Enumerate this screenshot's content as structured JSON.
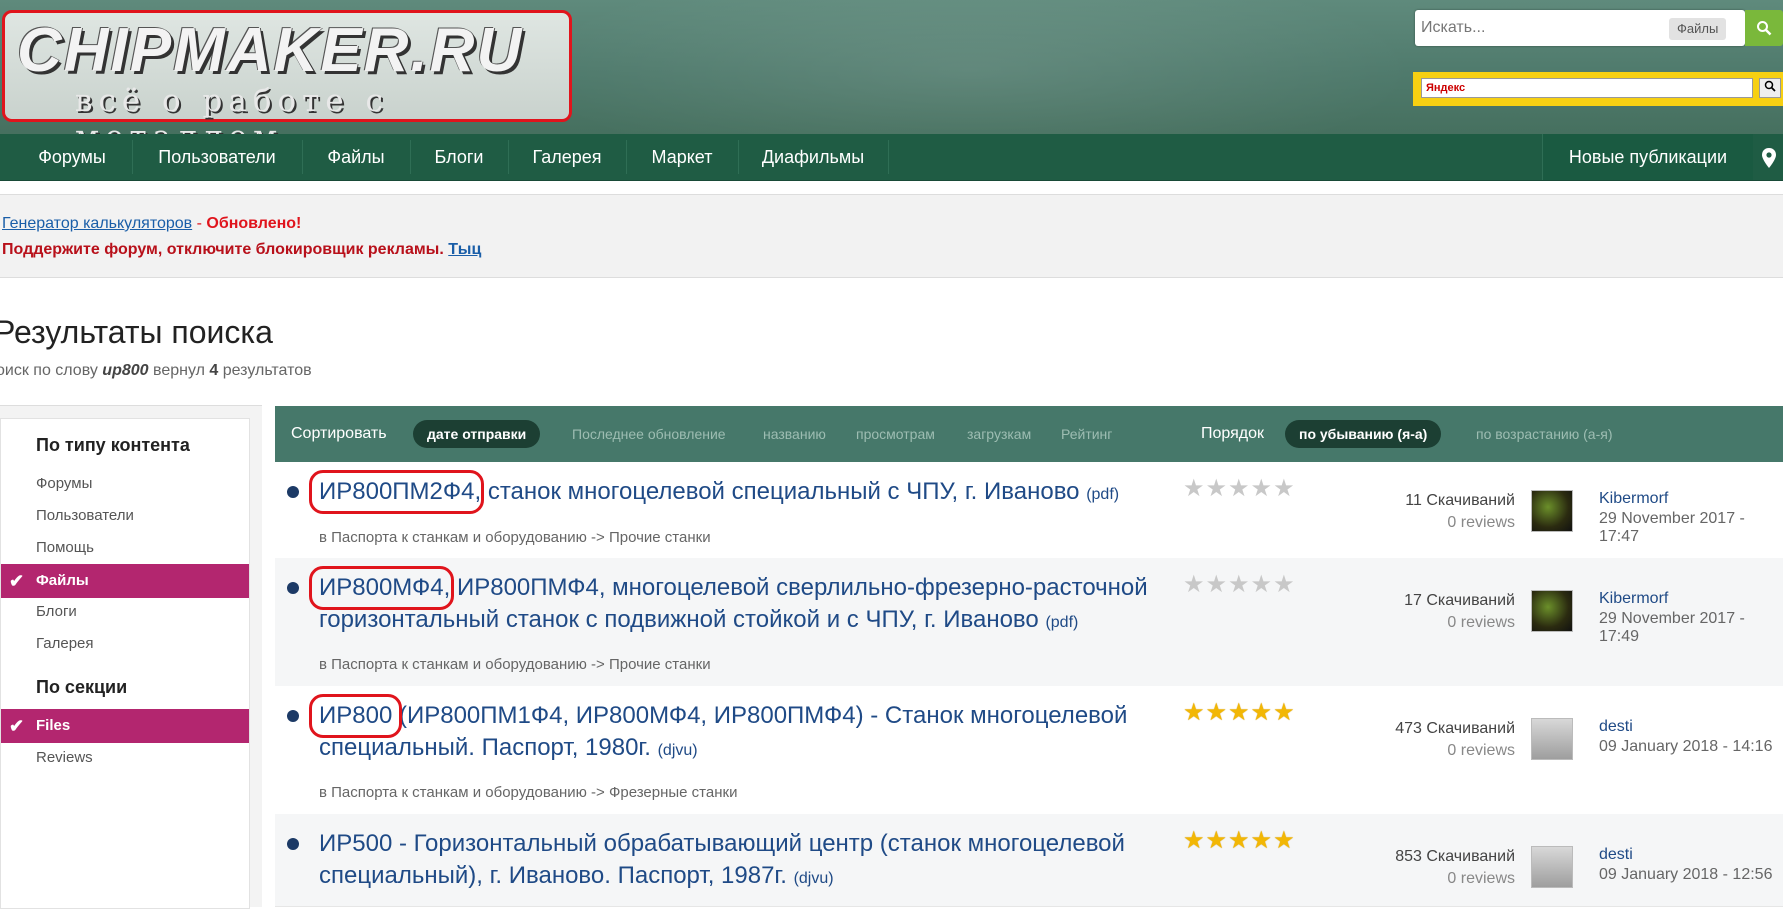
{
  "header": {
    "logo_title": "CHIPMAKER.RU",
    "logo_subtitle": "всё о работе с металлом",
    "search_placeholder": "Искать...",
    "search_scope": "Файлы",
    "yandex_label": "Яндекс"
  },
  "nav": {
    "items": [
      "Форумы",
      "Пользователи",
      "Файлы",
      "Блоги",
      "Галерея",
      "Маркет",
      "Диафильмы"
    ],
    "right": "Новые публикации"
  },
  "notice": {
    "link1": "Генератор калькуляторов",
    "sep": " - ",
    "updated": "Обновлено!",
    "support": "Поддержите форум, отключите блокировщик рекламы.",
    "link2": "Тыц"
  },
  "page": {
    "title": "Результаты поиска",
    "sub_prefix": "оиск по слову ",
    "query": "ир800",
    "sub_mid": " вернул ",
    "count": "4",
    "sub_suffix": " результатов"
  },
  "sidebar": {
    "heading1": "По типу контента",
    "types": [
      "Форумы",
      "Пользователи",
      "Помощь",
      "Файлы",
      "Блоги",
      "Галерея"
    ],
    "heading2": "По секции",
    "sections": [
      "Files",
      "Reviews"
    ]
  },
  "sortbar": {
    "sort_label": "Сортировать",
    "active": "дате отправки",
    "options": [
      "Последнее обновление",
      "названию",
      "просмотрам",
      "загрузкам",
      "Рейтинг"
    ],
    "order_label": "Порядок",
    "order_active": "по убыванию (я-а)",
    "order_other": "по возрастанию (а-я)"
  },
  "results": [
    {
      "hl": "ИР800ПМ2Ф4",
      "line1": ", станок многоцелевой специальный с ЧПУ, г. Иваново",
      "line2": "",
      "fmt": "(pdf)",
      "category": "в Паспорта к станкам и оборудованию -> Прочие станки",
      "rating": 0,
      "downloads": "11 Скачиваний",
      "reviews": "0 reviews",
      "author": "Kibermorf",
      "date": "29 November 2017 - 17:47"
    },
    {
      "hl": "ИР800МФ4",
      "line1": ", ИР800ПМФ4, многоцелевой сверлильно-фрезерно-расточной",
      "line2": "горизонтальный станок с подвижной стойкой и с ЧПУ, г. Иваново",
      "fmt": "(pdf)",
      "category": "в Паспорта к станкам и оборудованию -> Прочие станки",
      "rating": 0,
      "downloads": "17 Скачиваний",
      "reviews": "0 reviews",
      "author": "Kibermorf",
      "date": "29 November 2017 - 17:49"
    },
    {
      "hl": "ИР800",
      "line1": " (ИР800ПМ1Ф4, ИР800МФ4, ИР800ПМФ4) - Станок многоцелевой",
      "line2": "специальный. Паспорт, 1980г.",
      "fmt": "(djvu)",
      "category": "в Паспорта к станкам и оборудованию -> Фрезерные станки",
      "rating": 5,
      "downloads": "473 Скачиваний",
      "reviews": "0 reviews",
      "author": "desti",
      "date": "09 January 2018 - 14:16"
    },
    {
      "hl": "",
      "line1": "ИР500 - Горизонтальный обрабатывающий центр (станок многоцелевой",
      "line2": "специальный), г. Иваново. Паспорт, 1987г.",
      "fmt": "(djvu)",
      "category": "",
      "rating": 5,
      "downloads": "853 Скачиваний",
      "reviews": "0 reviews",
      "author": "desti",
      "date": "09 January 2018 - 12:56"
    }
  ],
  "colors": {
    "nav_bg": "#1f5c44",
    "sortbar_bg": "#46786a",
    "active_pink": "#b3266f",
    "link_blue": "#1f4a86",
    "highlight_red": "#e0141c",
    "star_gold": "#f2b705"
  }
}
